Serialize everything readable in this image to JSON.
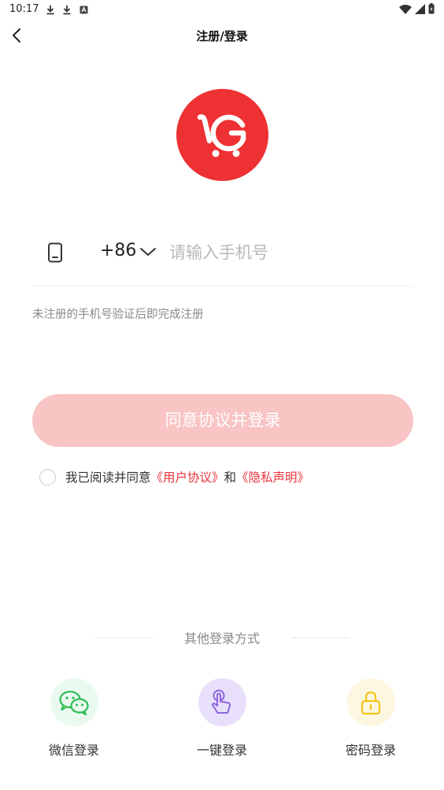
{
  "status_bar": {
    "time": "10:17",
    "icons": [
      "download-icon",
      "download-icon",
      "notification-icon"
    ],
    "right_icons": [
      "wifi-icon",
      "signal-icon",
      "battery-icon"
    ]
  },
  "header": {
    "title": "注册/登录",
    "back_icon": "chevron-left-icon"
  },
  "logo": {
    "color": "#ee3133",
    "icon": "cart-g-logo"
  },
  "phone": {
    "country_code": "+86",
    "placeholder": "请输入手机号",
    "value": ""
  },
  "hint": "未注册的手机号验证后即完成注册",
  "login_button": {
    "label": "同意协议并登录",
    "color": "#f8c4c4"
  },
  "agreement": {
    "prefix": "我已阅读并同意",
    "user_agreement": "《用户协议》",
    "and": "和",
    "privacy": "《隐私声明》",
    "link_color": "#e8333a"
  },
  "other_login": {
    "title": "其他登录方式",
    "options": [
      {
        "label": "微信登录",
        "icon": "wechat-icon",
        "color": "#2ebd55"
      },
      {
        "label": "一键登录",
        "icon": "tap-icon",
        "color": "#8d63e0"
      },
      {
        "label": "密码登录",
        "icon": "lock-icon",
        "color": "#f5c518"
      }
    ]
  }
}
